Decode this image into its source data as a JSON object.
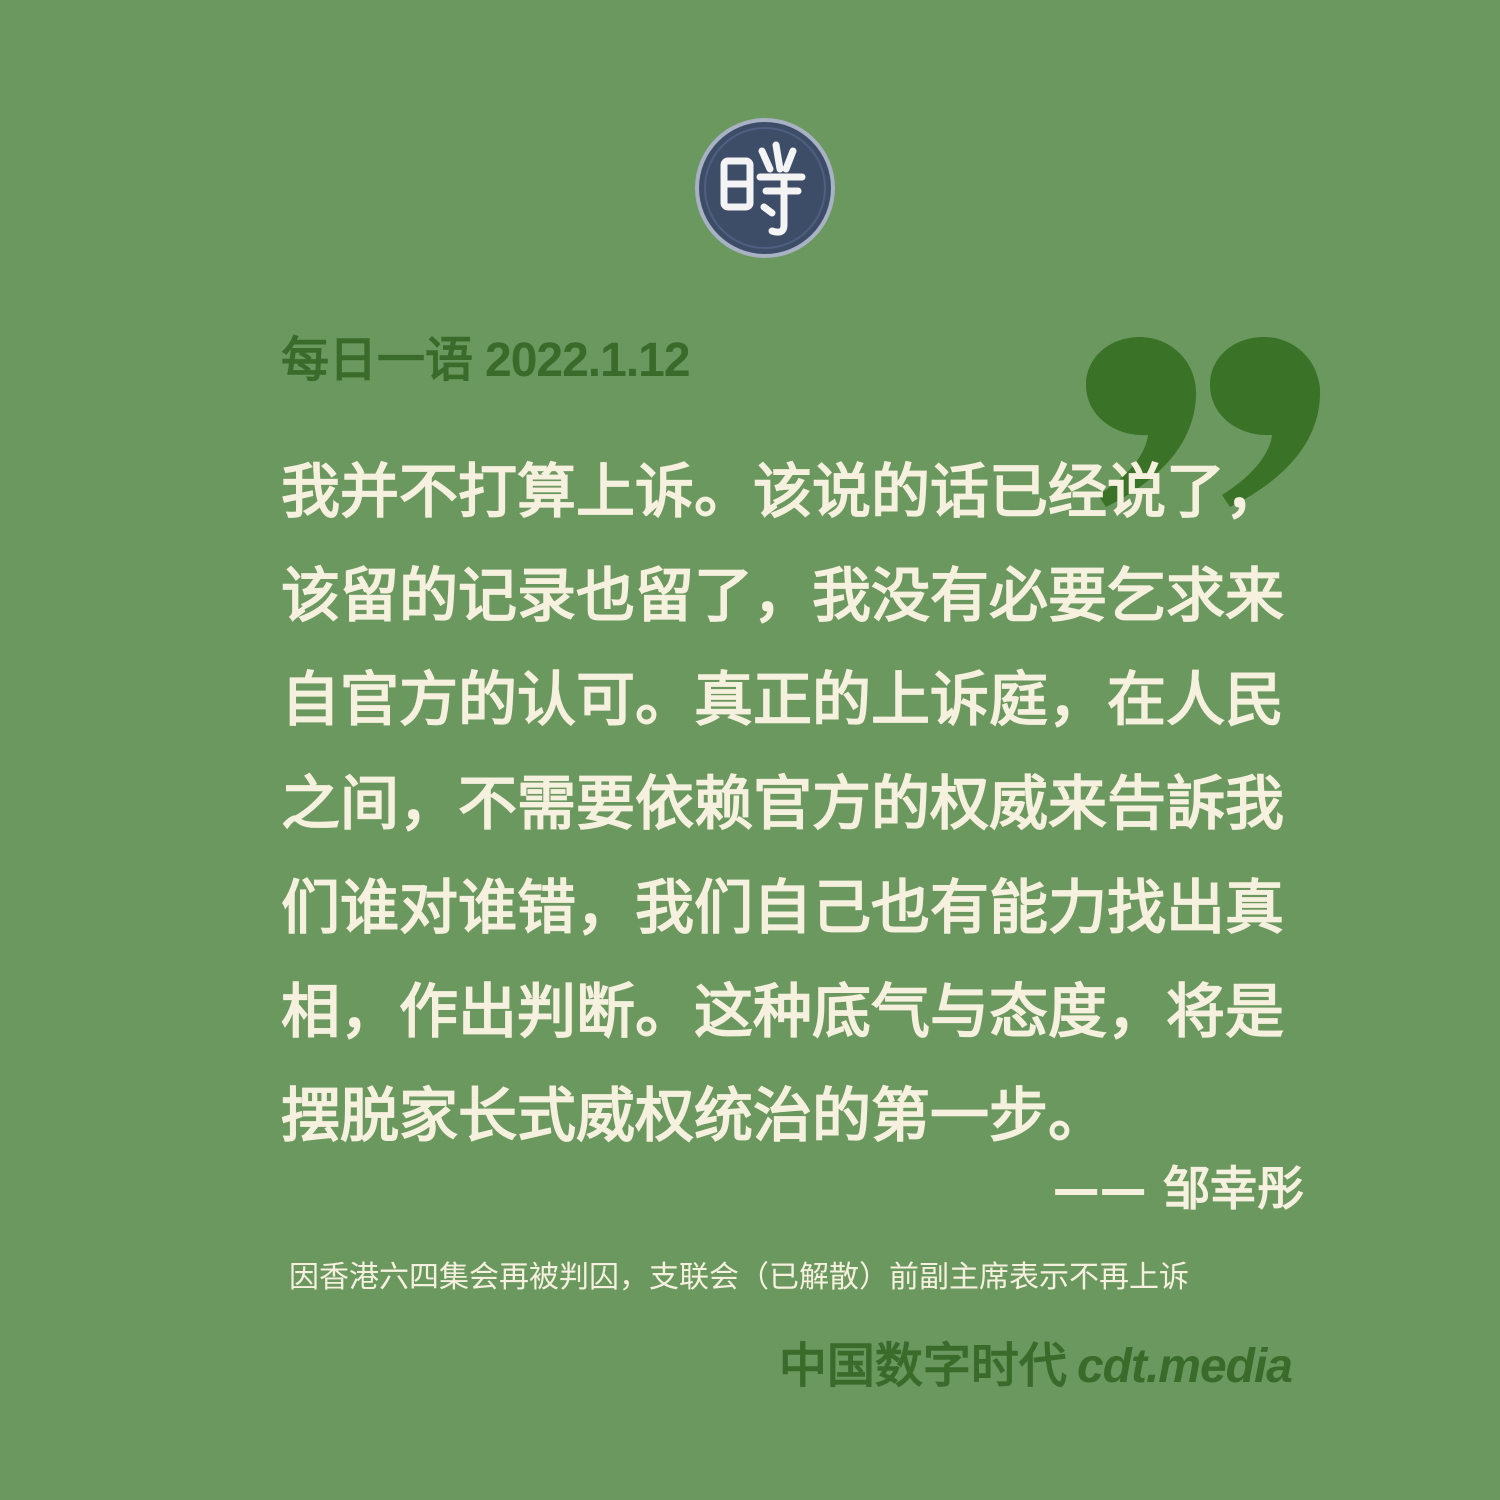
{
  "heading": {
    "label": "每日一语",
    "date": "2022.1.12"
  },
  "quote": {
    "lines": [
      "我并不打算上诉。该说的话已经说了，",
      "该留的记录也留了，我没有必要乞求来",
      "自官方的认可。真正的上诉庭，在人民",
      "之间，不需要依赖官方的权威来告訴我",
      "们谁对谁错，我们自己也有能力找出真",
      "相，作出判断。这种底气与态度，将是",
      "摆脱家长式威权统治的第一步。"
    ],
    "author": "—— 邹幸彤"
  },
  "context": "因香港六四集会再被判囚，支联会（已解散）前副主席表示不再上诉",
  "brand": {
    "name": "中国数字时代",
    "site": "cdt.media"
  },
  "logo": {
    "icon": "chinese-seal-logo-icon",
    "glyph": "时"
  },
  "colors": {
    "background": "#6b985f",
    "accent": "#3a6b2b",
    "text": "#f6f0df",
    "logo_fill": "#3d4d68"
  }
}
